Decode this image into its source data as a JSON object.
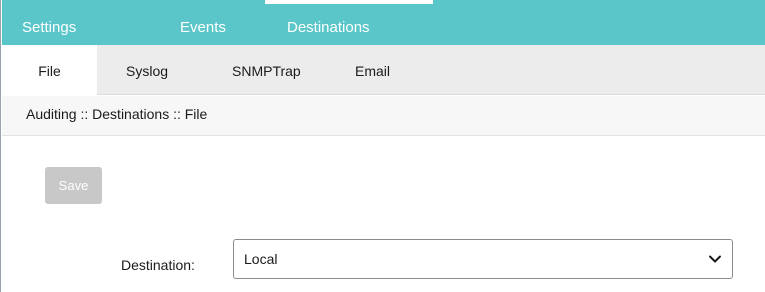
{
  "top_tabs": [
    {
      "label": "Settings"
    },
    {
      "label": "Events"
    },
    {
      "label": "Destinations"
    }
  ],
  "sub_tabs": [
    {
      "label": "File"
    },
    {
      "label": "Syslog"
    },
    {
      "label": "SNMPTrap"
    },
    {
      "label": "Email"
    }
  ],
  "breadcrumb": "Auditing :: Destinations :: File",
  "save_button": {
    "label": "Save",
    "enabled": false
  },
  "destination": {
    "label": "Destination:",
    "value": "Local"
  },
  "colors": {
    "topbar": "#5bc6c9",
    "subbar": "#ececec",
    "save_disabled": "#c8c8c8"
  }
}
